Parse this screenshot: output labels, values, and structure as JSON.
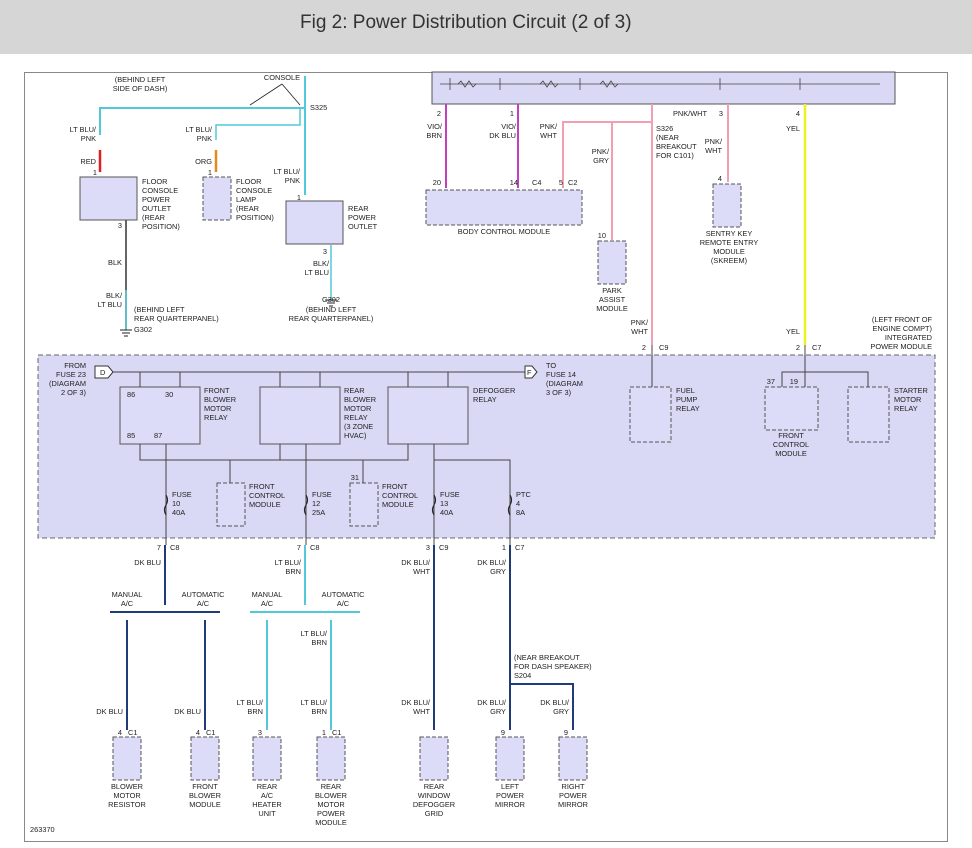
{
  "header": {
    "title": "Fig 2: Power Distribution Circuit (2 of 3)"
  },
  "figure_id": "263370",
  "colors": {
    "box_fill": "#d9d9f5",
    "box_stroke": "#555555",
    "module_fill": "#dcdcf8",
    "wire_lt_blu": "#52c8d8",
    "wire_dk_blu": "#1f3c78",
    "wire_pnk": "#f0a0b0",
    "wire_vio": "#c040c0",
    "wire_red": "#e02020",
    "wire_org": "#e08a20",
    "wire_yel": "#f0f020",
    "wire_black": "#333333",
    "wire_gray": "#777777"
  },
  "labels": {
    "console": "CONSOLE",
    "behind_dash": [
      "(BEHIND LEFT",
      "SIDE OF DASH)"
    ],
    "s325": "S325",
    "ltblu_pnk_a": [
      "LT BLU/",
      "PNK"
    ],
    "ltblu_pnk_b": [
      "LT BLU/",
      "PNK"
    ],
    "ltblu_pnk_c": [
      "LT BLU/",
      "PNK"
    ],
    "red": "RED",
    "org": "ORG",
    "pin_1a": "1",
    "pin_1b": "1",
    "pin_1c": "1",
    "pin_3a": "3",
    "pin_3b": "3",
    "floor_outlet": [
      "FLOOR",
      "CONSOLE",
      "POWER",
      "OUTLET",
      "(REAR",
      "POSITION)"
    ],
    "floor_lamp": [
      "FLOOR",
      "CONSOLE",
      "LAMP",
      "(REAR",
      "POSITION)"
    ],
    "rear_outlet": [
      "REAR",
      "POWER",
      "OUTLET"
    ],
    "blk": "BLK",
    "blk_ltblu_a": [
      "BLK/",
      "LT BLU"
    ],
    "blk_ltblu_b": [
      "BLK/",
      "LT BLU"
    ],
    "g302_a": "G302",
    "g302_b": "G302",
    "behind_rqp_a": [
      "(BEHIND LEFT",
      "REAR QUARTERPANEL)"
    ],
    "behind_rqp_b": [
      "(BEHIND LEFT",
      "REAR QUARTERPANEL)"
    ],
    "vio_brn": [
      "VIO/",
      "BRN"
    ],
    "vio_dkblu": [
      "VIO/",
      "DK BLU"
    ],
    "pnk_wht_a": [
      "PNK/",
      "WHT"
    ],
    "pnk_gry": [
      "PNK/",
      "GRY"
    ],
    "pnk_wht_top": "PNK/WHT",
    "pnk_wht_b": [
      "PNK/",
      "WHT"
    ],
    "pnk_wht_c": [
      "PNK/",
      "WHT"
    ],
    "yel_a": "YEL",
    "yel_b": "YEL",
    "pin_2": "2",
    "pin_1d": "1",
    "pin_3c": "3",
    "pin_4a": "4",
    "pin_4b": "4",
    "s326": [
      "S326",
      "(NEAR",
      "BREAKOUT",
      "FOR C101)"
    ],
    "pin_20": "20",
    "pin_14": "14",
    "c4": "C4",
    "pin_5": "5",
    "c2": "C2",
    "bcm": "BODY CONTROL MODULE",
    "pin_10": "10",
    "park_assist": [
      "PARK",
      "ASSIST",
      "MODULE"
    ],
    "sentry": [
      "SENTRY KEY",
      "REMOTE ENTRY",
      "MODULE",
      "(SKREEM)"
    ],
    "ipm": [
      "(LEFT FRONT OF",
      "ENGINE COMPT)",
      "INTEGRATED",
      "POWER MODULE"
    ],
    "pin_2b": "2",
    "c9a": "C9",
    "pin_2c": "2",
    "c7a": "C7",
    "from_fuse": [
      "FROM",
      "FUSE 23",
      "(DIAGRAM",
      "2 OF 3)"
    ],
    "to_fuse": [
      "TO",
      "FUSE 14",
      "(DIAGRAM",
      "3 OF 3)"
    ],
    "flag_d": "D",
    "flag_f": "F",
    "relay1": [
      "FRONT",
      "BLOWER",
      "MOTOR",
      "RELAY"
    ],
    "relay2": [
      "REAR",
      "BLOWER",
      "MOTOR",
      "RELAY",
      "(3 ZONE",
      "HVAC)"
    ],
    "relay3": [
      "DEFOGGER",
      "RELAY"
    ],
    "fuel_pump": [
      "FUEL",
      "PUMP",
      "RELAY"
    ],
    "starter": [
      "STARTER",
      "MOTOR",
      "RELAY"
    ],
    "fcm_big": [
      "FRONT",
      "CONTROL",
      "MODULE"
    ],
    "fcm_a": [
      "FRONT",
      "CONTROL",
      "MODULE"
    ],
    "fcm_b": [
      "FRONT",
      "CONTROL",
      "MODULE"
    ],
    "pin_86": "86",
    "pin_30": "30",
    "pin_85": "85",
    "pin_87": "87",
    "pin_37": "37",
    "pin_19": "19",
    "pin_31": "31",
    "fuse10": [
      "FUSE",
      "10",
      "40A"
    ],
    "fuse12": [
      "FUSE",
      "12",
      "25A"
    ],
    "fuse13": [
      "FUSE",
      "13",
      "40A"
    ],
    "ptc4": [
      "PTC",
      "4",
      "8A"
    ],
    "pin_7a": "7",
    "c8a": "C8",
    "pin_7b": "7",
    "c8b": "C8",
    "pin_3d": "3",
    "c9b": "C9",
    "pin_1e": "1",
    "c7b": "C7",
    "dkblu": "DK BLU",
    "ltblu_brn": [
      "LT BLU/",
      "BRN"
    ],
    "dkblu_wht": [
      "DK BLU/",
      "WHT"
    ],
    "dkblu_gry": [
      "DK BLU/",
      "GRY"
    ],
    "manual_ac_a": [
      "MANUAL",
      "A/C"
    ],
    "auto_ac_a": [
      "AUTOMATIC",
      "A/C"
    ],
    "manual_ac_b": [
      "MANUAL",
      "A/C"
    ],
    "auto_ac_b": [
      "AUTOMATIC",
      "A/C"
    ],
    "ltblu_brn_mid": [
      "LT BLU/",
      "BRN"
    ],
    "dkblu_1": "DK BLU",
    "dkblu_2": "DK BLU",
    "ltblu_brn_1": [
      "LT BLU/",
      "BRN"
    ],
    "ltblu_brn_2": [
      "LT BLU/",
      "BRN"
    ],
    "dkblu_wht_2": [
      "DK BLU/",
      "WHT"
    ],
    "dkblu_gry_2": [
      "DK BLU/",
      "GRY"
    ],
    "dkblu_gry_3": [
      "DK BLU/",
      "GRY"
    ],
    "s204": [
      "(NEAR BREAKOUT",
      "FOR DASH SPEAKER)",
      "S204"
    ],
    "pin_4c": "4",
    "c1a": "C1",
    "pin_4d": "4",
    "c1b": "C1",
    "pin_3e": "3",
    "pin_1f": "1",
    "c1c": "C1",
    "pin_9a": "9",
    "pin_9b": "9",
    "c_blower_res": [
      "BLOWER",
      "MOTOR",
      "RESISTOR"
    ],
    "c_front_blower": [
      "FRONT",
      "BLOWER",
      "MODULE"
    ],
    "c_heater": [
      "REAR",
      "A/C",
      "HEATER",
      "UNIT"
    ],
    "c_rear_blower": [
      "REAR",
      "BLOWER",
      "MOTOR",
      "POWER",
      "MODULE"
    ],
    "c_defog": [
      "REAR",
      "WINDOW",
      "DEFOGGER",
      "GRID"
    ],
    "c_left_mirror": [
      "LEFT",
      "POWER",
      "MIRROR"
    ],
    "c_right_mirror": [
      "RIGHT",
      "POWER",
      "MIRROR"
    ]
  }
}
